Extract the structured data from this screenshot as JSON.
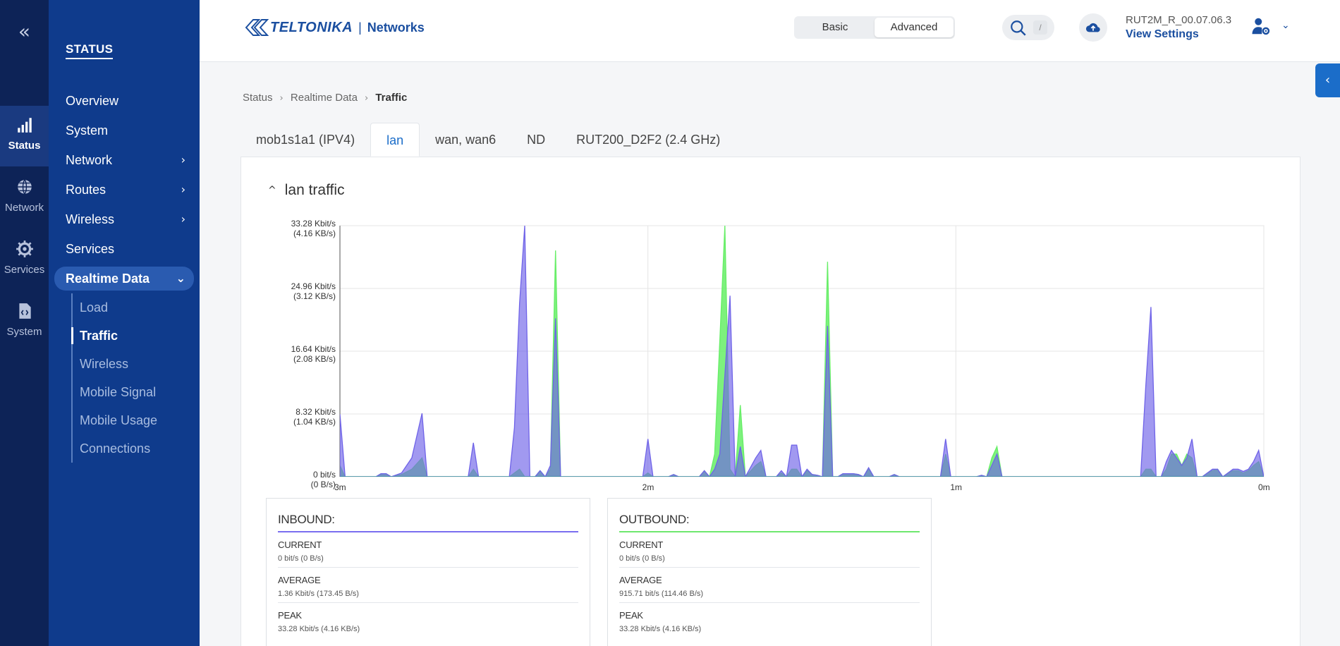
{
  "rail": {
    "items": [
      {
        "label": "Status",
        "icon": "signal-bars-icon"
      },
      {
        "label": "Network",
        "icon": "globe-icon"
      },
      {
        "label": "Services",
        "icon": "gear-icon"
      },
      {
        "label": "System",
        "icon": "code-file-icon"
      }
    ]
  },
  "menu": {
    "title": "STATUS",
    "items": [
      {
        "label": "Overview"
      },
      {
        "label": "System"
      },
      {
        "label": "Network",
        "chevron": "›"
      },
      {
        "label": "Routes",
        "chevron": "›"
      },
      {
        "label": "Wireless",
        "chevron": "›"
      },
      {
        "label": "Services"
      },
      {
        "label": "Realtime Data",
        "chevron": "⌄"
      }
    ],
    "submenu": [
      "Load",
      "Traffic",
      "Wireless",
      "Mobile Signal",
      "Mobile Usage",
      "Connections"
    ]
  },
  "header": {
    "logo_brand": "TELTONIKA",
    "logo_sep": "|",
    "logo_sub": "Networks",
    "mode_basic": "Basic",
    "mode_advanced": "Advanced",
    "search_key": "/",
    "fw_version": "RUT2M_R_00.07.06.3",
    "fw_link": "View Settings"
  },
  "breadcrumb": {
    "items": [
      "Status",
      "Realtime Data"
    ],
    "current": "Traffic"
  },
  "tabs": [
    "mob1s1a1 (IPV4)",
    "lan",
    "wan, wan6",
    "ND",
    "RUT200_D2F2 (2.4 GHz)"
  ],
  "card": {
    "title": "lan traffic"
  },
  "chart_data": {
    "type": "area",
    "x_labels": [
      "3m",
      "2m",
      "1m",
      "0m"
    ],
    "y_ticks": [
      {
        "line1": "33.28 Kbit/s",
        "line2": "(4.16 KB/s)",
        "value": 33.28
      },
      {
        "line1": "24.96 Kbit/s",
        "line2": "(3.12 KB/s)",
        "value": 24.96
      },
      {
        "line1": "16.64 Kbit/s",
        "line2": "(2.08 KB/s)",
        "value": 16.64
      },
      {
        "line1": "8.32 Kbit/s",
        "line2": "(1.04 KB/s)",
        "value": 8.32
      },
      {
        "line1": "0 bit/s",
        "line2": "(0 B/s)",
        "value": 0
      }
    ],
    "ylim": [
      0,
      33.28
    ],
    "xlim": [
      180,
      0
    ],
    "colors": {
      "inbound": "#6f63e8",
      "outbound": "#66ee66",
      "overlap": "#3e8fa2"
    },
    "series": [
      {
        "name": "inbound",
        "points": [
          [
            180,
            8.3
          ],
          [
            179,
            0
          ],
          [
            173,
            0
          ],
          [
            172,
            0.4
          ],
          [
            171,
            0.4
          ],
          [
            170,
            0
          ],
          [
            168,
            0.5
          ],
          [
            166,
            2.5
          ],
          [
            164,
            8.4
          ],
          [
            163,
            0
          ],
          [
            155,
            0
          ],
          [
            154,
            4.5
          ],
          [
            153,
            0
          ],
          [
            147,
            0
          ],
          [
            146,
            6.5
          ],
          [
            145,
            23
          ],
          [
            144,
            33.28
          ],
          [
            143,
            0
          ],
          [
            142,
            0
          ],
          [
            141,
            0.8
          ],
          [
            140,
            0
          ],
          [
            139,
            1.5
          ],
          [
            138,
            21
          ],
          [
            137,
            0
          ],
          [
            131,
            0
          ],
          [
            121,
            0
          ],
          [
            120,
            5
          ],
          [
            119,
            0
          ],
          [
            116,
            0
          ],
          [
            115,
            0.3
          ],
          [
            114,
            0
          ],
          [
            110,
            0
          ],
          [
            109,
            0.8
          ],
          [
            108,
            0
          ],
          [
            107,
            1
          ],
          [
            106,
            3
          ],
          [
            104,
            24
          ],
          [
            103,
            0
          ],
          [
            102,
            4
          ],
          [
            101,
            0
          ],
          [
            99,
            2.5
          ],
          [
            98,
            3.5
          ],
          [
            97,
            0
          ],
          [
            95,
            0
          ],
          [
            94,
            0.8
          ],
          [
            93,
            0
          ],
          [
            92,
            4.2
          ],
          [
            91,
            4.2
          ],
          [
            90,
            0
          ],
          [
            89,
            1
          ],
          [
            88,
            0.3
          ],
          [
            87,
            0.2
          ],
          [
            86,
            0
          ],
          [
            85,
            20
          ],
          [
            84,
            0
          ],
          [
            83,
            0
          ],
          [
            82,
            0.4
          ],
          [
            80,
            0.4
          ],
          [
            79,
            0.3
          ],
          [
            78,
            0
          ],
          [
            77,
            1.2
          ],
          [
            76,
            0
          ],
          [
            73,
            0
          ],
          [
            72,
            0.3
          ],
          [
            71,
            0
          ],
          [
            63,
            0
          ],
          [
            62,
            5
          ],
          [
            61,
            0
          ],
          [
            56,
            0
          ],
          [
            55,
            0.2
          ],
          [
            54,
            0
          ],
          [
            53,
            1.5
          ],
          [
            52,
            3
          ],
          [
            51,
            0
          ],
          [
            48,
            0
          ],
          [
            38,
            0
          ],
          [
            24,
            0
          ],
          [
            23,
            12
          ],
          [
            22,
            22.5
          ],
          [
            21,
            0
          ],
          [
            20,
            0
          ],
          [
            19,
            2
          ],
          [
            18,
            3.5
          ],
          [
            17,
            2.5
          ],
          [
            16,
            1.5
          ],
          [
            15,
            2.5
          ],
          [
            14,
            5
          ],
          [
            13,
            0
          ],
          [
            12,
            0
          ],
          [
            11,
            0.5
          ],
          [
            10,
            1
          ],
          [
            9,
            1
          ],
          [
            8,
            0
          ],
          [
            7,
            0.5
          ],
          [
            6,
            1
          ],
          [
            5,
            1
          ],
          [
            4,
            0.7
          ],
          [
            3,
            1
          ],
          [
            2,
            2
          ],
          [
            1,
            3.5
          ],
          [
            0,
            0
          ]
        ]
      },
      {
        "name": "outbound",
        "points": [
          [
            180,
            1.5
          ],
          [
            179,
            0
          ],
          [
            173,
            0
          ],
          [
            172,
            0.4
          ],
          [
            171,
            0.4
          ],
          [
            170,
            0
          ],
          [
            168,
            0.3
          ],
          [
            166,
            1
          ],
          [
            164,
            2.5
          ],
          [
            163,
            0
          ],
          [
            155,
            0
          ],
          [
            154,
            1
          ],
          [
            153,
            0
          ],
          [
            147,
            0
          ],
          [
            146,
            0.5
          ],
          [
            145,
            1
          ],
          [
            144,
            0
          ],
          [
            142,
            0
          ],
          [
            141,
            0.8
          ],
          [
            140,
            0
          ],
          [
            139,
            1
          ],
          [
            138,
            30
          ],
          [
            137,
            0
          ],
          [
            131,
            0
          ],
          [
            121,
            0
          ],
          [
            120,
            0.5
          ],
          [
            119,
            0
          ],
          [
            116,
            0
          ],
          [
            115,
            0.3
          ],
          [
            114,
            0
          ],
          [
            110,
            0
          ],
          [
            109,
            0.8
          ],
          [
            108,
            0
          ],
          [
            107,
            3
          ],
          [
            106,
            18
          ],
          [
            105,
            33.28
          ],
          [
            104,
            1
          ],
          [
            103,
            0
          ],
          [
            102,
            9.5
          ],
          [
            101,
            0
          ],
          [
            99,
            1.5
          ],
          [
            98,
            2
          ],
          [
            97,
            0
          ],
          [
            95,
            0
          ],
          [
            94,
            0.5
          ],
          [
            93,
            0
          ],
          [
            92,
            1
          ],
          [
            91,
            1
          ],
          [
            90,
            0
          ],
          [
            89,
            0.8
          ],
          [
            88,
            0.3
          ],
          [
            87,
            0.2
          ],
          [
            86,
            0
          ],
          [
            85,
            28.5
          ],
          [
            84,
            0
          ],
          [
            83,
            0
          ],
          [
            82,
            0.4
          ],
          [
            80,
            0.4
          ],
          [
            79,
            0.3
          ],
          [
            78,
            0
          ],
          [
            77,
            1
          ],
          [
            76,
            0
          ],
          [
            73,
            0
          ],
          [
            72,
            0.3
          ],
          [
            71,
            0
          ],
          [
            63,
            0
          ],
          [
            62,
            3
          ],
          [
            61,
            0
          ],
          [
            56,
            0
          ],
          [
            55,
            0.2
          ],
          [
            54,
            0
          ],
          [
            53,
            2.5
          ],
          [
            52,
            4
          ],
          [
            51,
            0
          ],
          [
            48,
            0
          ],
          [
            38,
            0
          ],
          [
            24,
            0
          ],
          [
            23,
            1
          ],
          [
            22,
            1
          ],
          [
            21,
            0
          ],
          [
            20,
            0
          ],
          [
            19,
            1
          ],
          [
            18,
            3
          ],
          [
            17,
            3
          ],
          [
            16,
            1.5
          ],
          [
            15,
            3
          ],
          [
            14,
            2.5
          ],
          [
            13,
            0
          ],
          [
            12,
            0
          ],
          [
            11,
            0.5
          ],
          [
            10,
            0.8
          ],
          [
            9,
            1
          ],
          [
            8,
            0
          ],
          [
            7,
            0.5
          ],
          [
            6,
            0.8
          ],
          [
            5,
            0.8
          ],
          [
            4,
            0.5
          ],
          [
            3,
            0.8
          ],
          [
            2,
            1.5
          ],
          [
            1,
            2
          ],
          [
            0,
            0
          ]
        ]
      }
    ]
  },
  "stats": {
    "inbound": {
      "title": "INBOUND:",
      "current_label": "CURRENT",
      "current": "0 bit/s (0 B/s)",
      "average_label": "AVERAGE",
      "average": "1.36 Kbit/s (173.45 B/s)",
      "peak_label": "PEAK",
      "peak": "33.28 Kbit/s (4.16 KB/s)"
    },
    "outbound": {
      "title": "OUTBOUND:",
      "current_label": "CURRENT",
      "current": "0 bit/s (0 B/s)",
      "average_label": "AVERAGE",
      "average": "915.71 bit/s (114.46 B/s)",
      "peak_label": "PEAK",
      "peak": "33.28 Kbit/s (4.16 KB/s)"
    }
  }
}
